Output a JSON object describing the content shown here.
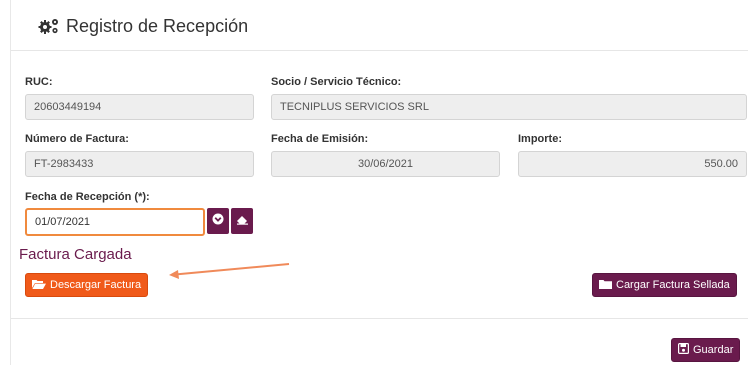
{
  "header": {
    "title": "Registro de Recepción",
    "icon": "gears-icon"
  },
  "form": {
    "ruc": {
      "label": "RUC:",
      "value": "20603449194"
    },
    "socio": {
      "label": "Socio / Servicio Técnico:",
      "value": "TECNIPLUS SERVICIOS SRL"
    },
    "factura": {
      "label": "Número de Factura:",
      "value": "FT-2983433"
    },
    "emision": {
      "label": "Fecha de Emisión:",
      "value": "30/06/2021"
    },
    "importe": {
      "label": "Importe:",
      "value": "550.00"
    },
    "recepcion": {
      "label": "Fecha de Recepción (*):",
      "value": "01/07/2021"
    }
  },
  "factura_cargada": {
    "title": "Factura Cargada",
    "download_label": "Descargar Factura",
    "upload_label": "Cargar Factura Sellada"
  },
  "footer": {
    "save_label": "Guardar"
  },
  "colors": {
    "primary": "#6a1b4d",
    "accent_orange": "#f05a1a",
    "focus_border": "#f08a3e"
  }
}
